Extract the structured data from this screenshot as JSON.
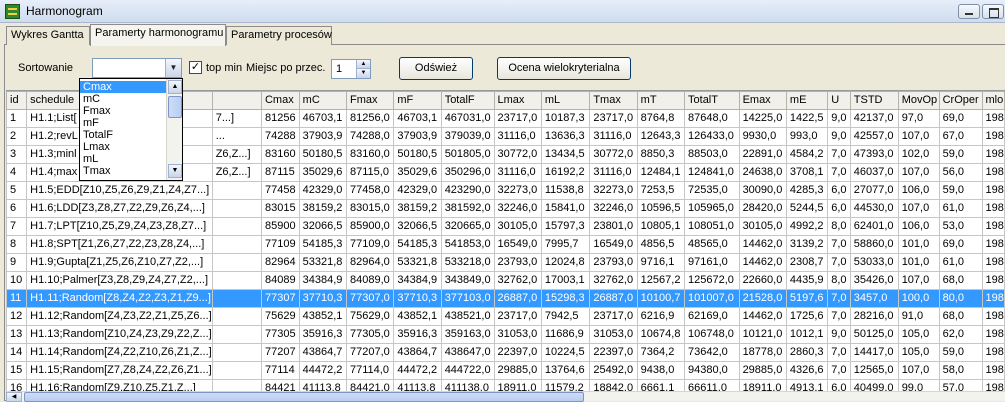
{
  "window": {
    "title": "Harmonogram"
  },
  "tabs": [
    {
      "label": "Wykres Gantta"
    },
    {
      "label": "Paramerty harmonogramu"
    },
    {
      "label": "Parametry procesów"
    }
  ],
  "controls": {
    "sort_label": "Sortowanie",
    "sort_value": "",
    "top_min_label": "top min",
    "top_min_checked": "✓",
    "places_label": "Miejsc po przec.",
    "places_value": "1",
    "refresh_button": "Odśwież",
    "multi_button": "Ocena wielokryterialna"
  },
  "sort_options": [
    "Cmax",
    "mC",
    "Fmax",
    "mF",
    "TotalF",
    "Lmax",
    "mL",
    "Tmax"
  ],
  "grid": {
    "columns": [
      "id",
      "schedule",
      "",
      "Cmax",
      "mC",
      "Fmax",
      "mF",
      "TotalF",
      "Lmax",
      "mL",
      "Tmax",
      "mT",
      "TotalT",
      "Emax",
      "mE",
      "U",
      "TSTD",
      "MovOp",
      "CrOper",
      "mlo"
    ],
    "selected_row": 10,
    "rows": [
      [
        "1",
        "H1.1;List[",
        "7...]",
        "81256",
        "46703,1",
        "81256,0",
        "46703,1",
        "467031,0",
        "23717,0",
        "10187,3",
        "23717,0",
        "8764,8",
        "87648,0",
        "14225,0",
        "1422,5",
        "9,0",
        "42137,0",
        "97,0",
        "69,0",
        "198"
      ],
      [
        "2",
        "H1.2;revL",
        "...",
        "74288",
        "37903,9",
        "74288,0",
        "37903,9",
        "379039,0",
        "31116,0",
        "13636,3",
        "31116,0",
        "12643,3",
        "126433,0",
        "9930,0",
        "993,0",
        "9,0",
        "42557,0",
        "107,0",
        "67,0",
        "198"
      ],
      [
        "3",
        "H1.3;minl",
        "Z6,Z...]",
        "83160",
        "50180,5",
        "83160,0",
        "50180,5",
        "501805,0",
        "30772,0",
        "13434,5",
        "30772,0",
        "8850,3",
        "88503,0",
        "22891,0",
        "4584,2",
        "7,0",
        "47393,0",
        "102,0",
        "59,0",
        "198"
      ],
      [
        "4",
        "H1.4;max",
        "Z6,Z...]",
        "87115",
        "35029,6",
        "87115,0",
        "35029,6",
        "350296,0",
        "31116,0",
        "16192,2",
        "31116,0",
        "12484,1",
        "124841,0",
        "24638,0",
        "3708,1",
        "7,0",
        "46037,0",
        "107,0",
        "56,0",
        "198"
      ],
      [
        "5",
        "H1.5;EDD[Z10,Z5,Z6,Z9,Z1,Z4,Z7...]",
        "",
        "77458",
        "42329,0",
        "77458,0",
        "42329,0",
        "423290,0",
        "32273,0",
        "11538,8",
        "32273,0",
        "7253,5",
        "72535,0",
        "30090,0",
        "4285,3",
        "6,0",
        "27077,0",
        "106,0",
        "59,0",
        "198"
      ],
      [
        "6",
        "H1.6;LDD[Z3,Z8,Z7,Z2,Z9,Z6,Z4,...]",
        "",
        "83015",
        "38159,2",
        "83015,0",
        "38159,2",
        "381592,0",
        "32246,0",
        "15841,0",
        "32246,0",
        "10596,5",
        "105965,0",
        "28420,0",
        "5244,5",
        "6,0",
        "44530,0",
        "107,0",
        "61,0",
        "198"
      ],
      [
        "7",
        "H1.7;LPT[Z10,Z5,Z9,Z4,Z3,Z8,Z7...]",
        "",
        "85900",
        "32066,5",
        "85900,0",
        "32066,5",
        "320665,0",
        "30105,0",
        "15797,3",
        "23801,0",
        "10805,1",
        "108051,0",
        "30105,0",
        "4992,2",
        "8,0",
        "62401,0",
        "106,0",
        "53,0",
        "198"
      ],
      [
        "8",
        "H1.8;SPT[Z1,Z6,Z7,Z2,Z3,Z8,Z4,...]",
        "",
        "77109",
        "54185,3",
        "77109,0",
        "54185,3",
        "541853,0",
        "16549,0",
        "7995,7",
        "16549,0",
        "4856,5",
        "48565,0",
        "14462,0",
        "3139,2",
        "7,0",
        "58860,0",
        "101,0",
        "69,0",
        "198"
      ],
      [
        "9",
        "H1.9;Gupta[Z1,Z5,Z6,Z10,Z7,Z2,...]",
        "",
        "82964",
        "53321,8",
        "82964,0",
        "53321,8",
        "533218,0",
        "23793,0",
        "12024,8",
        "23793,0",
        "9716,1",
        "97161,0",
        "14462,0",
        "2308,7",
        "7,0",
        "53033,0",
        "101,0",
        "61,0",
        "198"
      ],
      [
        "10",
        "H1.10;Palmer[Z3,Z8,Z9,Z4,Z7,Z2,...]",
        "",
        "84089",
        "34384,9",
        "84089,0",
        "34384,9",
        "343849,0",
        "32762,0",
        "17003,1",
        "32762,0",
        "12567,2",
        "125672,0",
        "22660,0",
        "4435,9",
        "8,0",
        "35426,0",
        "107,0",
        "68,0",
        "198"
      ],
      [
        "11",
        "H1.11;Random[Z8,Z4,Z2,Z3,Z1,Z9...]",
        "",
        "77307",
        "37710,3",
        "77307,0",
        "37710,3",
        "377103,0",
        "26887,0",
        "15298,3",
        "26887,0",
        "10100,7",
        "101007,0",
        "21528,0",
        "5197,6",
        "7,0",
        "3457,0",
        "100,0",
        "80,0",
        "198"
      ],
      [
        "12",
        "H1.12;Random[Z4,Z3,Z2,Z1,Z5,Z6...]",
        "",
        "75629",
        "43852,1",
        "75629,0",
        "43852,1",
        "438521,0",
        "23717,0",
        "7942,5",
        "23717,0",
        "6216,9",
        "62169,0",
        "14462,0",
        "1725,6",
        "7,0",
        "28216,0",
        "91,0",
        "68,0",
        "198"
      ],
      [
        "13",
        "H1.13;Random[Z10,Z4,Z3,Z9,Z2,Z...]",
        "",
        "77305",
        "35916,3",
        "77305,0",
        "35916,3",
        "359163,0",
        "31053,0",
        "11686,9",
        "31053,0",
        "10674,8",
        "106748,0",
        "10121,0",
        "1012,1",
        "9,0",
        "50125,0",
        "105,0",
        "62,0",
        "198"
      ],
      [
        "14",
        "H1.14;Random[Z4,Z2,Z10,Z6,Z1,Z...]",
        "",
        "77207",
        "43864,7",
        "77207,0",
        "43864,7",
        "438647,0",
        "22397,0",
        "10224,5",
        "22397,0",
        "7364,2",
        "73642,0",
        "18778,0",
        "2860,3",
        "7,0",
        "14417,0",
        "105,0",
        "59,0",
        "198"
      ],
      [
        "15",
        "H1.15;Random[Z7,Z8,Z4,Z2,Z6,Z1...]",
        "",
        "77114",
        "44472,2",
        "77114,0",
        "44472,2",
        "444722,0",
        "29885,0",
        "13764,6",
        "25492,0",
        "9438,0",
        "94380,0",
        "29885,0",
        "4326,6",
        "7,0",
        "12565,0",
        "107,0",
        "58,0",
        "198"
      ],
      [
        "16",
        "H1.16;Random[Z9,Z10,Z5,Z1,Z...]",
        "",
        "84421",
        "41113,8",
        "84421,0",
        "41113,8",
        "411138,0",
        "18911,0",
        "11579,2",
        "18842,0",
        "6661,1",
        "66611,0",
        "18911,0",
        "4913,1",
        "6,0",
        "40499,0",
        "99,0",
        "57,0",
        "198"
      ]
    ]
  }
}
